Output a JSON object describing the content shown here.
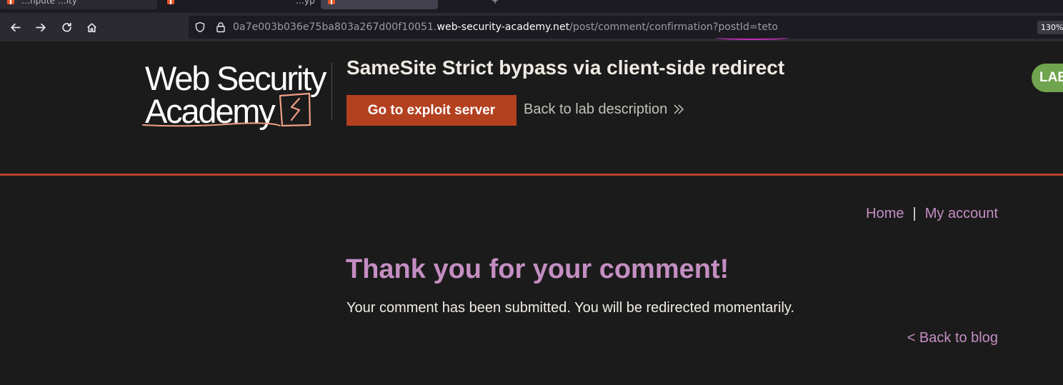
{
  "browser": {
    "tabs": [
      {
        "label": "…npute …ity"
      },
      {
        "label": "…yp"
      },
      {
        "label": ""
      }
    ],
    "new_tab_glyph": "+",
    "url_prefix": "0a7e003b036e75ba803a267d00f10051.",
    "url_host": "web-security-academy.net",
    "url_path": "/post/comment/confirmation?postId=teto",
    "zoom": "130%"
  },
  "header": {
    "logo_line1": "Web Security",
    "logo_line2": "Academy",
    "lab_title": "SameSite Strict bypass via client-side redirect",
    "exploit_button": "Go to exploit server",
    "back_to_lab": "Back to lab description",
    "status": "LAB",
    "status_color": "#70a44e",
    "accent_color": "#b3401f"
  },
  "nav": {
    "home": "Home",
    "separator": "|",
    "account": "My account"
  },
  "main": {
    "heading": "Thank you for your comment!",
    "message": "Your comment has been submitted. You will be redirected momentarily.",
    "back_to_blog": "< Back to blog"
  }
}
